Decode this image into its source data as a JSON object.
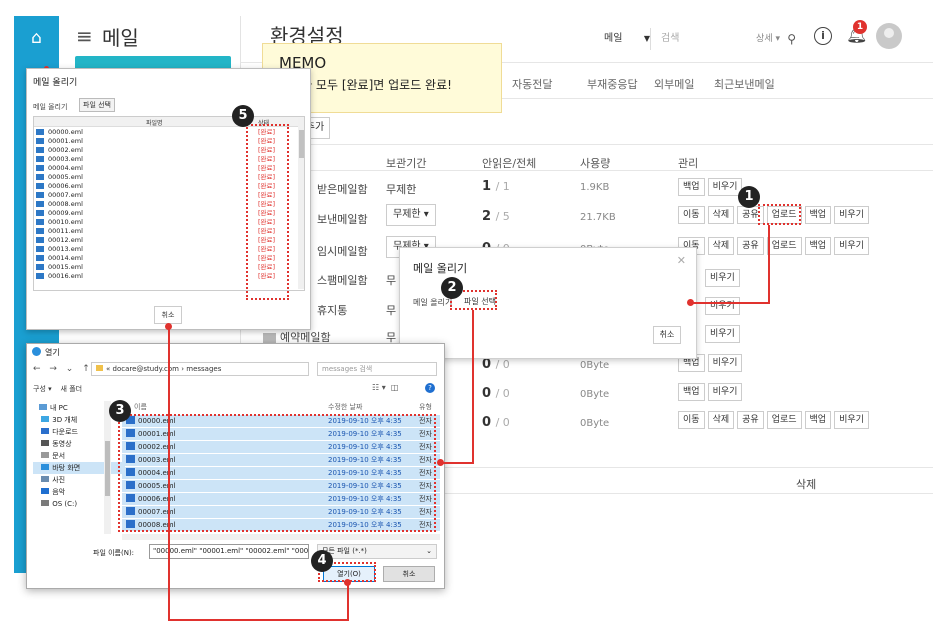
{
  "app": {
    "title": "메일",
    "page_title": "환경설정"
  },
  "toolbar": {
    "mail_select": "메일",
    "search_placeholder": "검색",
    "detail": "상세",
    "notif_count": "1"
  },
  "tabs": [
    "자동전달",
    "부재중응답",
    "외부메일",
    "최근보낸메일"
  ],
  "add_button": "추가",
  "table": {
    "headers": [
      "보관기간",
      "안읽은/전체",
      "사용량",
      "관리"
    ],
    "rows": [
      {
        "name": "받은메일함",
        "retention": "무제한",
        "unread": "1",
        "total": "1",
        "size": "1.9KB",
        "buttons": [
          "백업",
          "비우기"
        ]
      },
      {
        "name": "보낸메일함",
        "retention": "무제한",
        "unread": "2",
        "total": "5",
        "size": "21.7KB",
        "buttons": [
          "이동",
          "삭제",
          "공유",
          "업로드",
          "백업",
          "비우기"
        ]
      },
      {
        "name": "임시메일함",
        "retention": "무제한",
        "unread": "0",
        "total": "0",
        "size": "0Byte",
        "buttons": [
          "이동",
          "삭제",
          "공유",
          "업로드",
          "백업",
          "비우기"
        ]
      },
      {
        "name": "스팸메일함",
        "retention": "무",
        "unread": "",
        "total": "",
        "size": "",
        "buttons": [
          "비우기"
        ]
      },
      {
        "name": "휴지통",
        "retention": "무",
        "unread": "",
        "total": "",
        "size": "",
        "buttons": [
          "비우기"
        ]
      },
      {
        "name": "예약메일함",
        "retention": "무",
        "unread": "",
        "total": "",
        "size": "",
        "buttons": [
          "비우기"
        ]
      },
      {
        "name": "",
        "retention": "",
        "unread": "0",
        "total": "0",
        "size": "0Byte",
        "buttons": [
          "백업",
          "비우기"
        ]
      },
      {
        "name": "",
        "retention": "",
        "unread": "0",
        "total": "0",
        "size": "0Byte",
        "buttons": [
          "백업",
          "비우기"
        ]
      },
      {
        "name": "",
        "retention": "",
        "unread": "0",
        "total": "0",
        "size": "0Byte",
        "buttons": [
          "이동",
          "삭제",
          "공유",
          "업로드",
          "백업",
          "비우기"
        ]
      }
    ],
    "footer_delete": "삭제"
  },
  "memo": {
    "title": "MEMO",
    "text": "상태가 모두 [완료]면 업로드 완료!"
  },
  "upload_dialog_small": {
    "title": "메일 올리기",
    "label": "메일 올리기",
    "file_select": "파일 선택",
    "cancel": "취소"
  },
  "upload_dialog_big": {
    "title": "메일 올리기",
    "label": "메일 올리기",
    "file_select": "파일 선택",
    "col_filename": "파일명",
    "col_status": "상태",
    "files": [
      "00000.eml",
      "00001.eml",
      "00002.eml",
      "00003.eml",
      "00004.eml",
      "00005.eml",
      "00006.eml",
      "00007.eml",
      "00008.eml",
      "00009.eml",
      "00010.eml",
      "00011.eml",
      "00012.eml",
      "00013.eml",
      "00014.eml",
      "00015.eml",
      "00016.eml"
    ],
    "status": "[완료]",
    "cancel": "취소"
  },
  "file_dialog": {
    "title": "열기",
    "path": "« docare@study.com › messages",
    "search_placeholder": "messages 검색",
    "organize": "구성 ▾",
    "new_folder": "새 폴더",
    "tree": [
      "내 PC",
      "3D 개체",
      "다운로드",
      "동영상",
      "문서",
      "바탕 화면",
      "사진",
      "음악",
      "OS (C:)"
    ],
    "col_name": "이름",
    "col_date": "수정한 날짜",
    "col_type": "유형",
    "files": [
      {
        "name": "00000.eml",
        "date": "2019-09-10 오후 4:35",
        "type": "전자"
      },
      {
        "name": "00001.eml",
        "date": "2019-09-10 오후 4:35",
        "type": "전자"
      },
      {
        "name": "00002.eml",
        "date": "2019-09-10 오후 4:35",
        "type": "전자"
      },
      {
        "name": "00003.eml",
        "date": "2019-09-10 오후 4:35",
        "type": "전자"
      },
      {
        "name": "00004.eml",
        "date": "2019-09-10 오후 4:35",
        "type": "전자"
      },
      {
        "name": "00005.eml",
        "date": "2019-09-10 오후 4:35",
        "type": "전자"
      },
      {
        "name": "00006.eml",
        "date": "2019-09-10 오후 4:35",
        "type": "전자"
      },
      {
        "name": "00007.eml",
        "date": "2019-09-10 오후 4:35",
        "type": "전자"
      },
      {
        "name": "00008.eml",
        "date": "2019-09-10 오후 4:35",
        "type": "전자"
      }
    ],
    "filename_label": "파일 이름(N):",
    "filename_value": "\"00000.eml\" \"00001.eml\" \"00002.eml\" \"0000",
    "filetype": "모든 파일 (*.*)",
    "open": "열기(O)",
    "cancel": "취소"
  },
  "steps": [
    "1",
    "2",
    "3",
    "4",
    "5"
  ],
  "colors": {
    "accent": "#1a9fd1",
    "annotation": "#e0322e",
    "memo_bg": "#fffbd9"
  }
}
